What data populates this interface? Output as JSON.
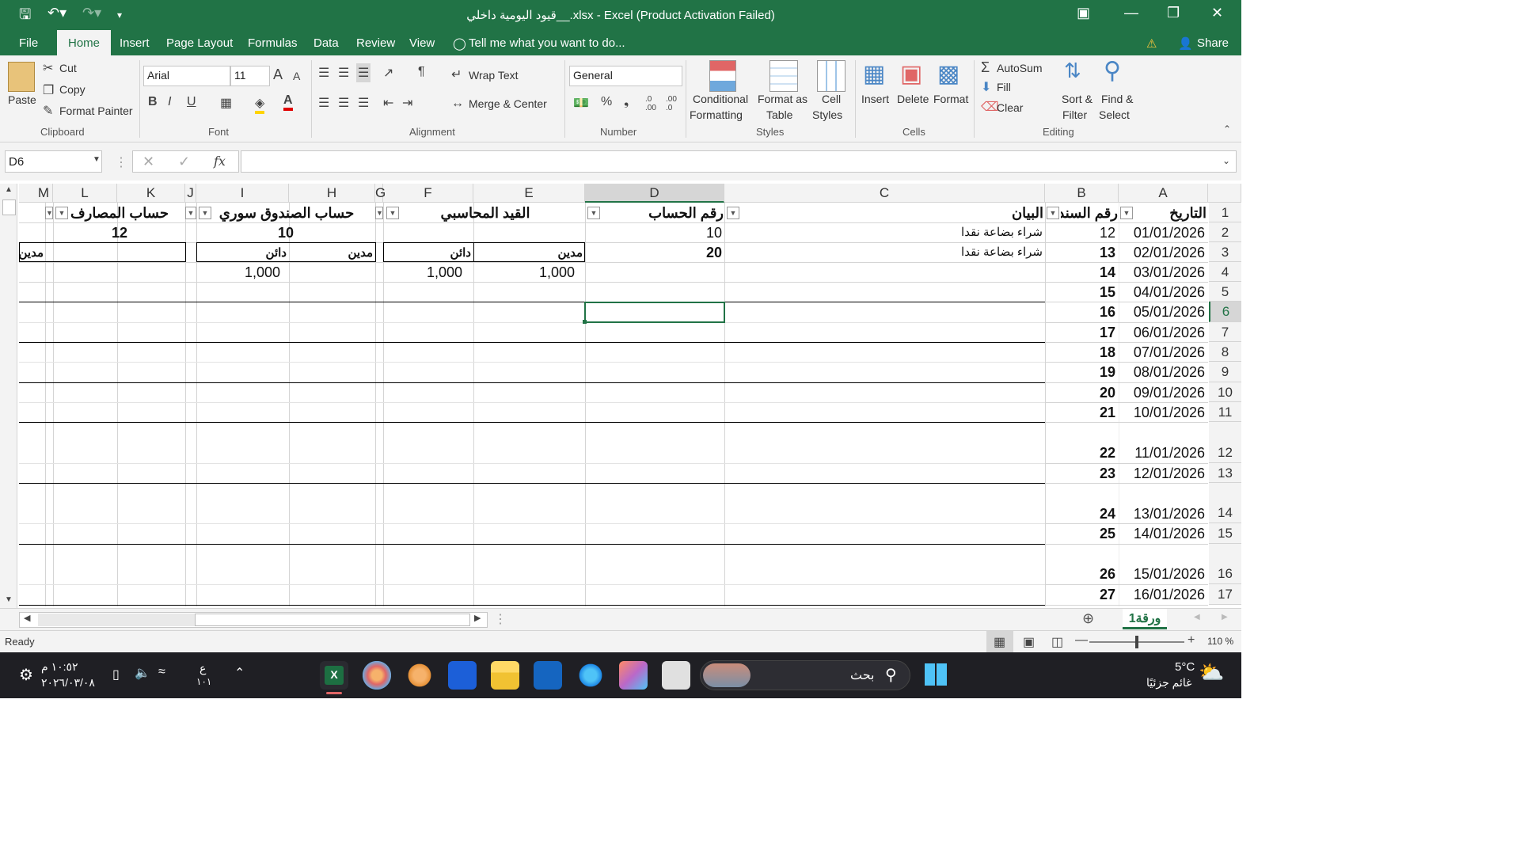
{
  "window": {
    "title": "قيود اليومية داخلي__.xlsx - Excel (Product Activation Failed)"
  },
  "menu": {
    "items": [
      "File",
      "Home",
      "Insert",
      "Page Layout",
      "Formulas",
      "Data",
      "Review",
      "View"
    ],
    "tell_me": "Tell me what you want to do...",
    "share": "Share"
  },
  "ribbon": {
    "clipboard": {
      "paste": "Paste",
      "cut": "Cut",
      "copy": "Copy",
      "format_painter": "Format Painter",
      "label": "Clipboard"
    },
    "font": {
      "name": "Arial",
      "size": "11",
      "label": "Font",
      "bold": "B",
      "italic": "I",
      "underline": "U"
    },
    "alignment": {
      "wrap": "Wrap Text",
      "merge": "Merge & Center",
      "label": "Alignment"
    },
    "number": {
      "format": "General",
      "label": "Number",
      "percent": "%",
      "comma": "❟",
      "inc": ".0 .00",
      "dec": ".00 .0"
    },
    "styles": {
      "conditional": [
        "Conditional",
        "Formatting"
      ],
      "format_table": [
        "Format as",
        "Table"
      ],
      "cell_styles": [
        "Cell",
        "Styles"
      ],
      "label": "Styles"
    },
    "cells": {
      "insert": "Insert",
      "delete": "Delete",
      "format": "Format",
      "label": "Cells"
    },
    "editing": {
      "autosum": "AutoSum",
      "fill": "Fill",
      "clear": "Clear",
      "sort": [
        "Sort &",
        "Filter"
      ],
      "find": [
        "Find &",
        "Select"
      ],
      "label": "Editing"
    }
  },
  "formula_bar": {
    "name_box": "D6",
    "fx": "fx",
    "value": ""
  },
  "columns": [
    "A",
    "B",
    "C",
    "D",
    "E",
    "F",
    "G",
    "H",
    "I",
    "J",
    "K",
    "L",
    "M"
  ],
  "rows": [
    "1",
    "2",
    "3",
    "4",
    "5",
    "6",
    "7",
    "8",
    "9",
    "10",
    "11",
    "12",
    "13",
    "14",
    "15",
    "16",
    "17"
  ],
  "headers": {
    "date": "التاريخ",
    "voucher": "رقم السند",
    "statement": "البيان",
    "account": "رقم الحساب",
    "entry": "القيد المحاسبي",
    "cash": "حساب الصندوق سوري",
    "expenses": "حساب المصارف"
  },
  "row2": {
    "date": "01/01/2026",
    "voucher": "12",
    "statement": "شراء بضاعة نقدا",
    "account": "10",
    "cash": "10",
    "expenses": "12"
  },
  "row3": {
    "date": "02/01/2026",
    "voucher": "13",
    "statement": "شراء بضاعة نقدا",
    "account": "20",
    "debit": "مدين",
    "credit": "دائن",
    "debit2": "مدين",
    "credit2": "دائن",
    "debit3": "مدين"
  },
  "row4": {
    "date": "03/01/2026",
    "voucher": "14",
    "e": "1,000",
    "f": "1,000",
    "i": "1,000"
  },
  "dates": [
    "04/01/2026",
    "05/01/2026",
    "06/01/2026",
    "07/01/2026",
    "08/01/2026",
    "09/01/2026",
    "10/01/2026",
    "11/01/2026",
    "12/01/2026",
    "13/01/2026",
    "14/01/2026",
    "15/01/2026",
    "16/01/2026"
  ],
  "vouchers": [
    "15",
    "16",
    "17",
    "18",
    "19",
    "20",
    "21",
    "22",
    "23",
    "24",
    "25",
    "26",
    "27"
  ],
  "sheet_tab": "ورقة1",
  "status": {
    "ready": "Ready",
    "zoom": "110 %"
  },
  "taskbar": {
    "time": "١٠:٥٢ م",
    "date": "٢٠٢٦/٠٣/٠٨",
    "search": "بحث",
    "weather_temp": "5°C",
    "weather_desc": "غائم جزئيًا",
    "lang": "ع",
    "lang2": "١٠١"
  }
}
